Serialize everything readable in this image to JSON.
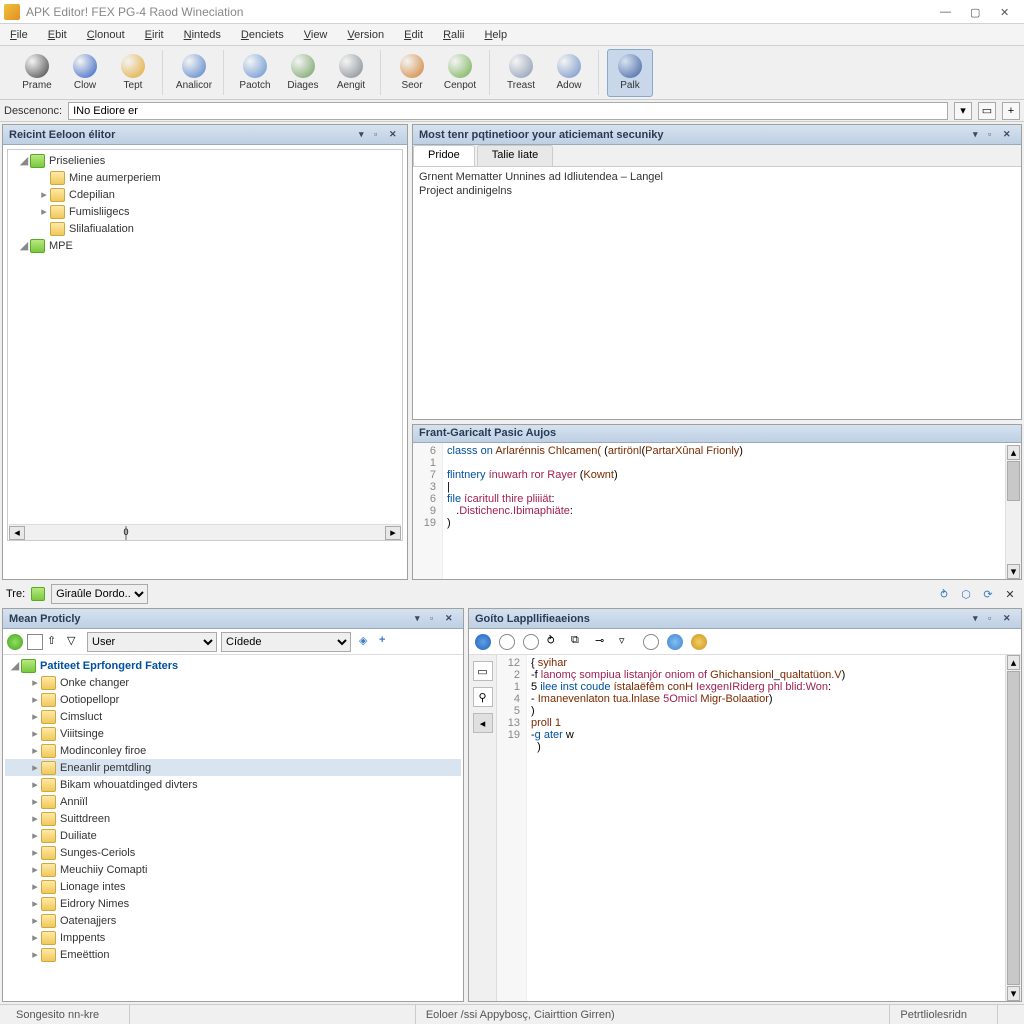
{
  "window": {
    "title": "APK Editor! FEX PG-4 Raod Wineciation"
  },
  "menu": [
    "File",
    "Ebit",
    "Clonout",
    "Eirit",
    "Ninteds",
    "Denciets",
    "View",
    "Version",
    "Edit",
    "Ralii",
    "Help"
  ],
  "toolbar": {
    "groups": [
      {
        "items": [
          {
            "label": "Prame",
            "color": "#404040"
          },
          {
            "label": "Clow",
            "color": "#3060c0"
          },
          {
            "label": "Tept",
            "color": "#e0a830"
          }
        ]
      },
      {
        "items": [
          {
            "label": "Analicor",
            "color": "#5080c8"
          }
        ]
      },
      {
        "items": [
          {
            "label": "Paotch",
            "color": "#6090d0"
          },
          {
            "label": "Diages",
            "color": "#70a060"
          },
          {
            "label": "Aengit",
            "color": "#808890"
          }
        ]
      },
      {
        "items": [
          {
            "label": "Seor",
            "color": "#d08030"
          },
          {
            "label": "Cenpot",
            "color": "#70b050"
          }
        ]
      },
      {
        "items": [
          {
            "label": "Treast",
            "color": "#8898b0"
          },
          {
            "label": "Adow",
            "color": "#7090c8"
          }
        ]
      },
      {
        "items": [
          {
            "label": "Palk",
            "color": "#4060a0",
            "active": true
          }
        ]
      }
    ]
  },
  "desc": {
    "label": "Descenonc:",
    "value": "INo Ediore er"
  },
  "left_explorer": {
    "title": "Reicint Eeloon élitor",
    "scroll_value": "0",
    "items": [
      {
        "label": "Priselienies",
        "icon": "proj",
        "depth": 0,
        "expanded": true
      },
      {
        "label": "Mine aumerperiem",
        "icon": "folder",
        "depth": 1
      },
      {
        "label": "Cdepilian",
        "icon": "folder",
        "depth": 1,
        "toggle": "▸"
      },
      {
        "label": "Fumisliigecs",
        "icon": "folder",
        "depth": 1,
        "toggle": "▸"
      },
      {
        "label": "Slilafiualation",
        "icon": "folder",
        "depth": 1
      },
      {
        "label": "MPE",
        "icon": "proj",
        "depth": 0,
        "expanded": true
      }
    ]
  },
  "info_panel": {
    "title": "Most tenr pqtinetioor your aticiemant secuniky",
    "tabs": [
      "Pridoe",
      "Talie Iiate"
    ],
    "active_tab": 0,
    "lines": [
      "Grnent Mematter Unnines ad Idliutendea – Langel",
      "Project andinigelns"
    ]
  },
  "code_panel": {
    "title": "Frant-Garicalt Pasic Aujos",
    "lines": [
      {
        "n": "6",
        "html": "<span class='kw'>classs</span> <span class='kw'>on </span><span class='fn'>Arlarénnis Chlcamen(</span> (<span class='fn'>artirönl</span>(<span class='fn'>PartarXûnal Frionly</span>)"
      },
      {
        "n": "1",
        "html": ""
      },
      {
        "n": "7",
        "html": "<span class='kw'>flintnery</span> <span class='str'>ínuwarh ror Rayer</span> (<span class='fn'>Kownt</span>)"
      },
      {
        "n": "3",
        "html": "|"
      },
      {
        "n": "6",
        "html": "<span class='kw'>file</span> <span class='str'>ícaritull thire pliiiät</span>:"
      },
      {
        "n": "9",
        "html": "   .<span class='str'>Distichenc.Ibimaphiäte</span>:"
      },
      {
        "n": "19",
        "html": "<span class='id'>)</span>"
      }
    ]
  },
  "trebar": {
    "label": "Tre:",
    "value": "Giraûle Dordo.."
  },
  "mean_panel": {
    "title": "Mean Proticly",
    "user_select": "User",
    "filter_select": "Cídede",
    "root": "Patiteet Eprfongerd Faters",
    "items": [
      "Onke changer",
      "Ootiopellopr",
      "Cimsluct",
      "Viiitsinge",
      "Modinconley firoe",
      "Eneanlir pemtdling",
      "Bikam whouatdinged divters",
      "Anniïl",
      "Suittdreen",
      "Duiliate",
      "Sunges-Ceriols",
      "Meuchiiy Comapti",
      "Lionage intes",
      "Eidrory Nimes",
      "Oatenajjers",
      "Imppents",
      "Emeëttion"
    ],
    "selected_index": 5
  },
  "goto_panel": {
    "title": "Goíto Lappllifieaeions",
    "lines": [
      {
        "n": "12",
        "html": "{ <span class='fn'>syihar</span>"
      },
      {
        "n": "2",
        "html": "-f <span class='str'>lanomç sompiua listanjór oniom of</span> <span class='fn'>Ghichansionl</span>_<span class='fn'>qualtatüon.V</span>)"
      },
      {
        "n": "1",
        "html": "5 <span class='kw'>ilee inst coude</span> <span class='fn'>ístalaëfêm conH</span> <span class='str'>IexgenIRiderg phl blid:Won</span>:"
      },
      {
        "n": "4",
        "html": "- <span class='fn'>Imanevenlaton tua.lnlase</span> <span class='str'>5Omicl</span> <span class='fn'>Migr-Bolaatior</span>)"
      },
      {
        "n": "5",
        "html": ")"
      },
      {
        "n": "13",
        "html": "<span class='fn'>proll 1</span>"
      },
      {
        "n": "19",
        "html": "-<span class='kw'>g ater</span> w"
      },
      {
        "n": "",
        "html": "  )"
      }
    ]
  },
  "status": {
    "left": "Songesito nn-kre",
    "mid": "Eoloer /ssi Appybosç, Ciairttion Girren)",
    "right": "Petrtliolesridn"
  }
}
